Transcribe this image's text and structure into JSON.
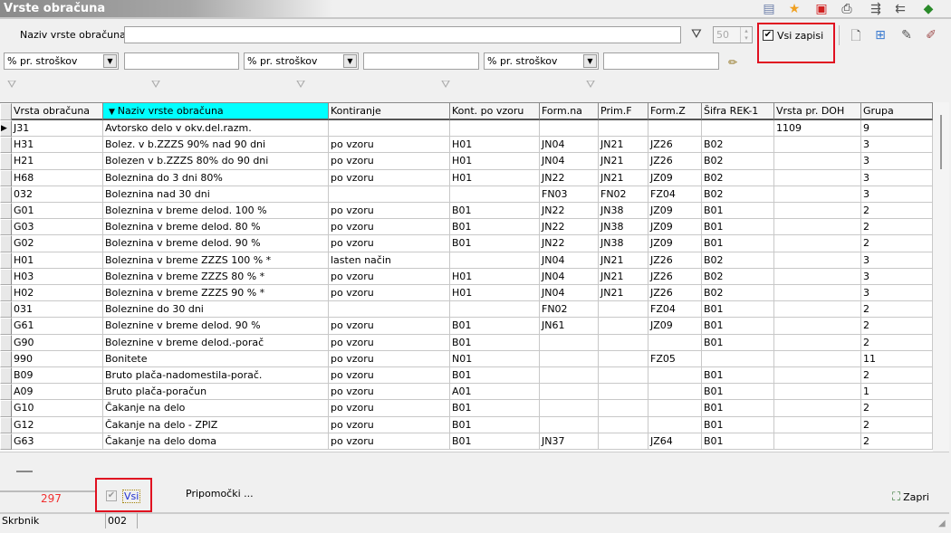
{
  "window": {
    "title": "Vrste obračuna"
  },
  "toolbar_icons": [
    "columns-icon",
    "star-icon",
    "delete-icon",
    "print-icon",
    "export-icon",
    "import-icon",
    "help-book-icon"
  ],
  "search": {
    "label": "Naziv vrste obračuna",
    "value": "",
    "limit": "50",
    "all_records_label": "Vsi zapisi",
    "all_records_checked": true
  },
  "filters": [
    {
      "field": "% pr. stroškov",
      "value": ""
    },
    {
      "field": "% pr. stroškov",
      "value": ""
    },
    {
      "field": "% pr. stroškov",
      "value": ""
    }
  ],
  "record_icons": [
    "new-record-icon",
    "copy-record-icon",
    "edit-record-icon",
    "edit-multiple-icon"
  ],
  "grid": {
    "columns": [
      "Vrsta obračuna",
      "Naziv vrste obračuna",
      "Kontiranje",
      "Kont. po vzoru",
      "Form.na",
      "Prim.F",
      "Form.Z",
      "Šifra REK-1",
      "Vrsta pr. DOH",
      "Grupa"
    ],
    "sorted_column": 1,
    "sorted_color": "#00ffff",
    "rows": [
      [
        "J31",
        "Avtorsko delo  v okv.del.razm.",
        "",
        "",
        "",
        "",
        "",
        "",
        "1109",
        "9"
      ],
      [
        "H31",
        "Bolez. v b.ZZZS 90% nad 90 dni",
        "po vzoru",
        "H01",
        "JN04",
        "JN21",
        "JZ26",
        "B02",
        "",
        "3"
      ],
      [
        "H21",
        "Bolezen v b.ZZZS 80% do 90 dni",
        "po vzoru",
        "H01",
        "JN04",
        "JN21",
        "JZ26",
        "B02",
        "",
        "3"
      ],
      [
        "H68",
        "Boleznina do 3 dni 80%",
        "po vzoru",
        "H01",
        "JN22",
        "JN21",
        "JZ09",
        "B02",
        "",
        "3"
      ],
      [
        "032",
        "Boleznina nad 30 dni",
        "",
        "",
        "FN03",
        "FN02",
        "FZ04",
        "B02",
        "",
        "3"
      ],
      [
        "G01",
        "Boleznina v breme delod. 100 %",
        "po vzoru",
        "B01",
        "JN22",
        "JN38",
        "JZ09",
        "B01",
        "",
        "2"
      ],
      [
        "G03",
        "Boleznina v breme delod. 80 %",
        "po vzoru",
        "B01",
        "JN22",
        "JN38",
        "JZ09",
        "B01",
        "",
        "2"
      ],
      [
        "G02",
        "Boleznina v breme delod. 90 %",
        "po vzoru",
        "B01",
        "JN22",
        "JN38",
        "JZ09",
        "B01",
        "",
        "2"
      ],
      [
        "H01",
        "Boleznina v breme ZZZS 100 % *",
        "lasten način",
        "",
        "JN04",
        "JN21",
        "JZ26",
        "B02",
        "",
        "3"
      ],
      [
        "H03",
        "Boleznina v breme ZZZS 80 % *",
        "po vzoru",
        "H01",
        "JN04",
        "JN21",
        "JZ26",
        "B02",
        "",
        "3"
      ],
      [
        "H02",
        "Boleznina v breme ZZZS 90 % *",
        "po vzoru",
        "H01",
        "JN04",
        "JN21",
        "JZ26",
        "B02",
        "",
        "3"
      ],
      [
        "031",
        "Boleznine do 30 dni",
        "",
        "",
        "FN02",
        "",
        "FZ04",
        "B01",
        "",
        "2"
      ],
      [
        "G61",
        "Boleznine v breme delod. 90 %",
        "po vzoru",
        "B01",
        "JN61",
        "",
        "JZ09",
        "B01",
        "",
        "2"
      ],
      [
        "G90",
        "Boleznine v breme delod.-porač",
        "po vzoru",
        "B01",
        "",
        "",
        "",
        "B01",
        "",
        "2"
      ],
      [
        "990",
        "Bonitete",
        "po vzoru",
        "N01",
        "",
        "",
        "FZ05",
        "",
        "",
        "11"
      ],
      [
        "B09",
        "Bruto plača-nadomestila-porač.",
        "po vzoru",
        "B01",
        "",
        "",
        "",
        "B01",
        "",
        "2"
      ],
      [
        "A09",
        "Bruto plača-poračun",
        "po vzoru",
        "A01",
        "",
        "",
        "",
        "B01",
        "",
        "1"
      ],
      [
        "G10",
        "Čakanje na delo",
        "po vzoru",
        "B01",
        "",
        "",
        "",
        "B01",
        "",
        "2"
      ],
      [
        "G12",
        "Čakanje na delo - ZPIZ",
        "po vzoru",
        "B01",
        "",
        "",
        "",
        "B01",
        "",
        "2"
      ],
      [
        "G63",
        "Čakanje na delo doma",
        "po vzoru",
        "B01",
        "JN37",
        "",
        "JZ64",
        "B01",
        "",
        "2"
      ]
    ]
  },
  "footer": {
    "count": "297",
    "all_label": "Vsi",
    "all_checked": true,
    "tools_label": "Pripomočki ...",
    "close_label": "Zapri"
  },
  "statusbar": {
    "label": "Skrbnik",
    "value": "002"
  }
}
